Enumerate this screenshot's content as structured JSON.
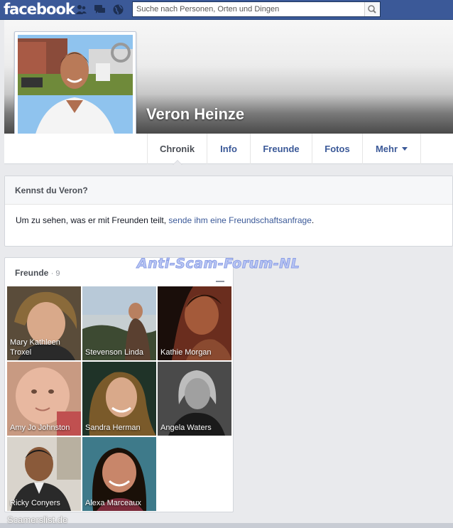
{
  "topbar": {
    "logo": "facebook",
    "search_placeholder": "Suche nach Personen, Orten und Dingen",
    "icons": [
      "friends-icon",
      "messages-icon",
      "globe-icon",
      "search-icon"
    ]
  },
  "profile": {
    "name": "Veron Heinze"
  },
  "nav": {
    "tabs": [
      "Chronik",
      "Info",
      "Freunde",
      "Fotos",
      "Mehr"
    ]
  },
  "kennst": {
    "title": "Kennst du Veron?",
    "text_before": "Um zu sehen, was er mit Freunden teilt, ",
    "link": "sende ihm eine Freundschaftsanfrage",
    "text_after": "."
  },
  "watermark": "Anti-Scam-Forum-NL",
  "friends": {
    "title": "Freunde",
    "count": "· 9",
    "items": [
      {
        "line1": "Mary Kathleen",
        "line2": "Troxel"
      },
      {
        "line1": "Stevenson Linda",
        "line2": ""
      },
      {
        "line1": "Kathie Morgan",
        "line2": ""
      },
      {
        "line1": "Amy Jo Johnston",
        "line2": ""
      },
      {
        "line1": "Sandra Herman",
        "line2": ""
      },
      {
        "line1": "Angela Waters",
        "line2": ""
      },
      {
        "line1": "Ricky Conyers",
        "line2": ""
      },
      {
        "line1": "Alexa Marceaux",
        "line2": ""
      }
    ]
  },
  "footer_mark": "Scamerslist.de",
  "colors": {
    "brand": "#3b5998",
    "background": "#e9eaed",
    "link": "#3b5998"
  }
}
